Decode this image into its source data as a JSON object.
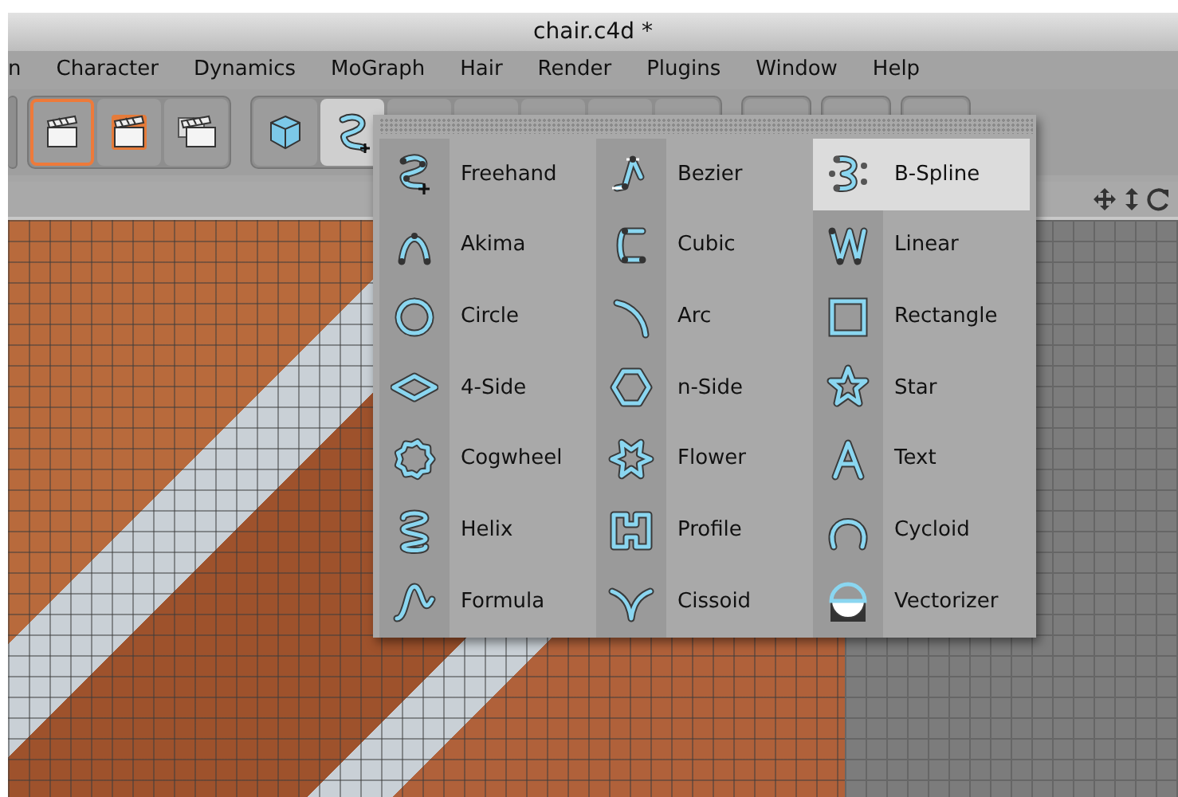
{
  "window": {
    "title": "chair.c4d *"
  },
  "menu_bar": [
    "n",
    "Character",
    "Dynamics",
    "MoGraph",
    "Hair",
    "Render",
    "Plugins",
    "Window",
    "Help"
  ],
  "toolbar_buttons": [
    {
      "kind": "clapper",
      "selected": true
    },
    {
      "kind": "clapper-orange",
      "selected": false
    },
    {
      "kind": "clapper-stack",
      "selected": false
    },
    {
      "kind": "cube",
      "selected": false
    },
    {
      "kind": "spline",
      "selected": true
    }
  ],
  "spline_menu": {
    "items": [
      {
        "label": "Freehand",
        "selected": false
      },
      {
        "label": "Bezier",
        "selected": false
      },
      {
        "label": "B-Spline",
        "selected": true
      },
      {
        "label": "Akima",
        "selected": false
      },
      {
        "label": "Cubic",
        "selected": false
      },
      {
        "label": "Linear",
        "selected": false
      },
      {
        "label": "Circle",
        "selected": false
      },
      {
        "label": "Arc",
        "selected": false
      },
      {
        "label": "Rectangle",
        "selected": false
      },
      {
        "label": "4-Side",
        "selected": false
      },
      {
        "label": "n-Side",
        "selected": false
      },
      {
        "label": "Star",
        "selected": false
      },
      {
        "label": "Cogwheel",
        "selected": false
      },
      {
        "label": "Flower",
        "selected": false
      },
      {
        "label": "Text",
        "selected": false
      },
      {
        "label": "Helix",
        "selected": false
      },
      {
        "label": "Profile",
        "selected": false
      },
      {
        "label": "Cycloid",
        "selected": false
      },
      {
        "label": "Formula",
        "selected": false
      },
      {
        "label": "Cissoid",
        "selected": false
      },
      {
        "label": "Vectorizer",
        "selected": false
      }
    ]
  }
}
